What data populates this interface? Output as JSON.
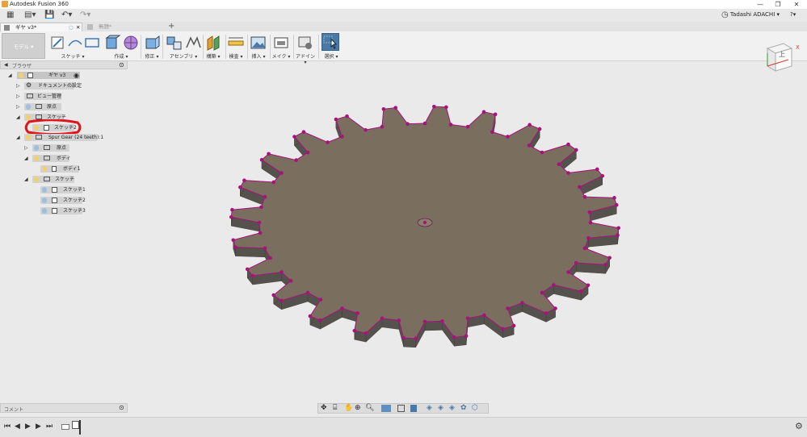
{
  "window": {
    "title": "Autodesk Fusion 360"
  },
  "quick_access": {
    "user_name": "Tadashi ADACHI ▾",
    "help_label": "?▾"
  },
  "tabs": [
    {
      "label": "ギヤ v3*",
      "active": true
    },
    {
      "label": "無題*",
      "active": false
    }
  ],
  "toolbar": {
    "workspace_label": "モデル ▾",
    "groups": [
      {
        "label": "スケッチ ▾"
      },
      {
        "label": "作成 ▾"
      },
      {
        "label": "修正 ▾"
      },
      {
        "label": "アセンブリ ▾"
      },
      {
        "label": "構築 ▾"
      },
      {
        "label": "検査 ▾"
      },
      {
        "label": "挿入 ▾"
      },
      {
        "label": "メイク ▾"
      },
      {
        "label": "アドイン ▾"
      },
      {
        "label": "選択 ▾"
      }
    ]
  },
  "browser": {
    "title": "ブラウザ",
    "items": [
      {
        "label": "ギヤ v3"
      },
      {
        "label": "ドキュメントの設定"
      },
      {
        "label": "ビュー管理"
      },
      {
        "label": "原点"
      },
      {
        "label": "スケッチ"
      },
      {
        "label": "スケッチ2"
      },
      {
        "label": "Spur Gear (24 teeth):1"
      },
      {
        "label": "原点"
      },
      {
        "label": "ボディ"
      },
      {
        "label": "ボディ1"
      },
      {
        "label": "スケッチ"
      },
      {
        "label": "スケッチ1"
      },
      {
        "label": "スケッチ2"
      },
      {
        "label": "スケッチ3"
      }
    ]
  },
  "comment_panel": {
    "title": "コメント"
  },
  "viewcube": {
    "face_label": "上",
    "axis_label": "X"
  },
  "gear": {
    "teeth": 24,
    "face_color": "#7a6e5e",
    "side_color": "#55524d",
    "vertex_color": "#a8127d"
  },
  "colors": {
    "accent": "#4a79a8",
    "highlight_ring": "#e0141b"
  }
}
